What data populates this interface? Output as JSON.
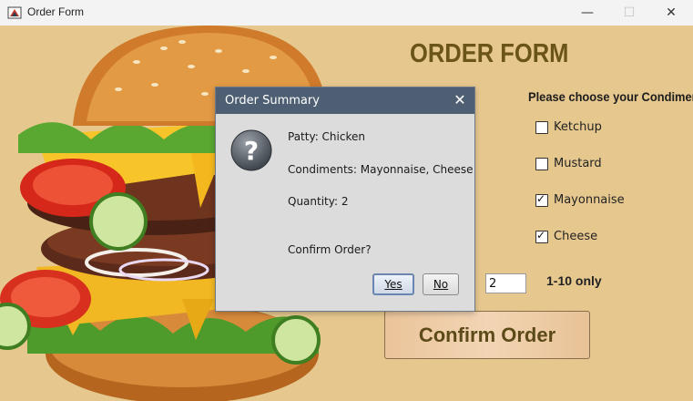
{
  "window": {
    "title": "Order Form",
    "minimize_glyph": "—",
    "maximize_glyph": "☐",
    "close_glyph": "✕"
  },
  "form": {
    "heading": "ORDER FORM",
    "condiments_label": "Please choose your Condiments:",
    "condiments": [
      {
        "label": "Ketchup",
        "checked": false
      },
      {
        "label": "Mustard",
        "checked": false
      },
      {
        "label": "Mayonnaise",
        "checked": true
      },
      {
        "label": "Cheese",
        "checked": true
      }
    ],
    "quantity_value": "2",
    "quantity_note": "1-10 only",
    "confirm_button": "Confirm Order"
  },
  "dialog": {
    "title": "Order Summary",
    "close_glyph": "✕",
    "icon": "question-icon",
    "lines": {
      "patty": "Patty: Chicken",
      "condiments": "Condiments: Mayonnaise, Cheese",
      "quantity": "Quantity: 2",
      "prompt": "Confirm Order?"
    },
    "yes_label": "Yes",
    "no_label": "No"
  }
}
